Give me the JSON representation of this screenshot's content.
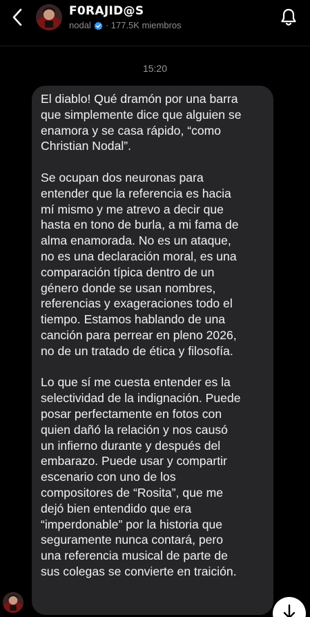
{
  "header": {
    "channel_name": "F0RAJID@S",
    "owner": "nodal",
    "members": "· 177.5K miembros",
    "back_icon": "chevron-left-icon",
    "notify_icon": "bell-icon"
  },
  "chat": {
    "timestamp": "15:20",
    "message": {
      "paragraphs": [
        "El diablo! Qué dramón por una barra\nque simplemente dice que alguien se\nenamora y se casa rápido, “como\nChristian Nodal”.",
        "Se ocupan dos neuronas para\nentender que la referencia es hacia\nmí mismo y me atrevo a decir que\nhasta en tono de burla, a mi fama de\nalma enamorada. No es un ataque,\nno es una declaración moral, es una\ncomparación típica dentro de un\ngénero donde se usan nombres,\nreferencias y exageraciones todo el\ntiempo. Estamos hablando de una\ncanción para perrear en pleno 2026,\nno de un tratado de ética y filosofía.",
        "Lo que sí me cuesta entender es la\nselectividad de la indignación. Puede\nposar perfectamente en fotos con\nquien dañó la relación y nos causó\nun infierno durante y después del\nembarazo. Puede usar y compartir\nescenario con uno de los\ncompositores de “Rosita”, que me\ndejó bien entendido que era\n“imperdonable” por la historia que\nseguramente nunca contará, pero\nuna referencia musical de parte de\nsus colegas se convierte en traición."
      ]
    },
    "scroll_icon": "arrow-down-icon"
  },
  "colors": {
    "background": "#000000",
    "bubble": "#262628",
    "muted_text": "#8e8e93",
    "verified_blue": "#3897f0"
  }
}
